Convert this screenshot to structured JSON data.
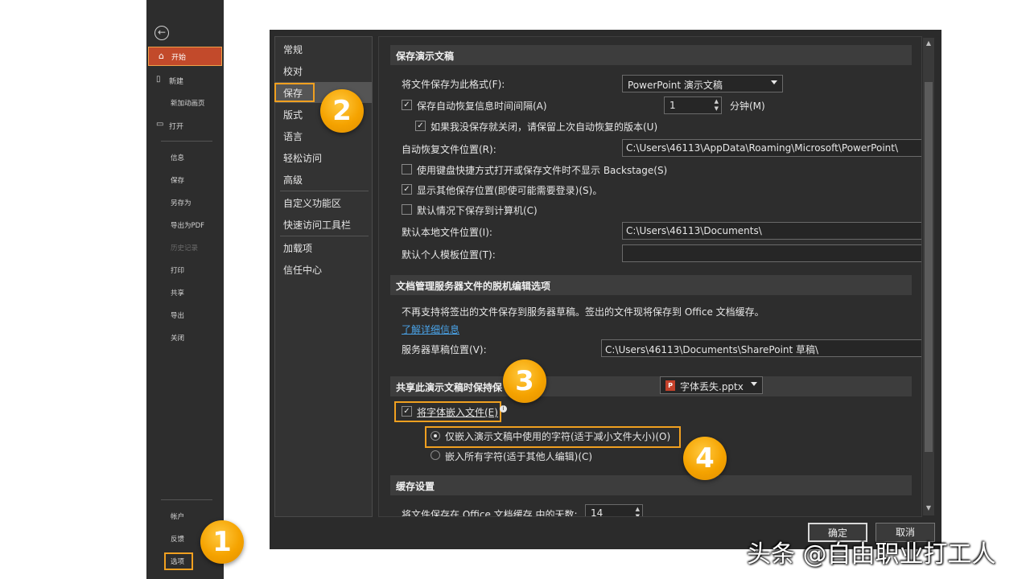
{
  "backstage": {
    "back_icon": "back-arrow-icon",
    "home": "开始",
    "new": "新建",
    "new_sub": "新加动画页",
    "open": "打开",
    "items": [
      "信息",
      "保存",
      "另存为",
      "导出为PDF",
      "历史记录",
      "打印",
      "共享",
      "导出",
      "关闭"
    ],
    "bottom": [
      "帐户",
      "反馈",
      "选项"
    ]
  },
  "categories": [
    "常规",
    "校对",
    "保存",
    "版式",
    "语言",
    "轻松访问",
    "高级",
    "自定义功能区",
    "快速访问工具栏",
    "加载项",
    "信任中心"
  ],
  "save_section": {
    "header": "保存演示文稿",
    "format_label": "将文件保存为此格式(F):",
    "format_value": "PowerPoint 演示文稿",
    "autorecover_label": "保存自动恢复信息时间间隔(A)",
    "autorecover_value": "1",
    "autorecover_unit": "分钟(M)",
    "keep_last_label": "如果我没保存就关闭，请保留上次自动恢复的版本(U)",
    "autorecover_path_label": "自动恢复文件位置(R):",
    "autorecover_path": "C:\\Users\\46113\\AppData\\Roaming\\Microsoft\\PowerPoint\\",
    "no_backstage_label": "使用键盘快捷方式打开或保存文件时不显示 Backstage(S)",
    "show_more_label": "显示其他保存位置(即使可能需要登录)(S)。",
    "save_to_computer_label": "默认情况下保存到计算机(C)",
    "local_path_label": "默认本地文件位置(I):",
    "local_path": "C:\\Users\\46113\\Documents\\",
    "template_path_label": "默认个人模板位置(T):",
    "template_path": ""
  },
  "offline_section": {
    "header": "文档管理服务器文件的脱机编辑选项",
    "note": "不再支持将签出的文件保存到服务器草稿。签出的文件现将保存到 Office 文档缓存。",
    "link": "了解详细信息",
    "drafts_label": "服务器草稿位置(V):",
    "drafts_path": "C:\\Users\\46113\\Documents\\SharePoint 草稿\\"
  },
  "fidelity_section": {
    "header": "共享此演示文稿时保持保",
    "file_value": "字体丢失.pptx",
    "file_icon": "powerpoint-file-icon",
    "embed_label": "将字体嵌入文件(E)",
    "info_icon": "info-icon",
    "embed_used_label": "仅嵌入演示文稿中使用的字符(适于减小文件大小)(O)",
    "embed_all_label": "嵌入所有字符(适于其他人编辑)(C)"
  },
  "cache_section": {
    "header": "缓存设置",
    "days_label": "将文件保存在 Office 文档缓存 中的天数:",
    "days_value": "14"
  },
  "buttons": {
    "ok": "确定",
    "cancel": "取消"
  },
  "badges": [
    "1",
    "2",
    "3",
    "4"
  ],
  "watermark": "头条 @自由职业打工人",
  "colors": {
    "accent_orange": "#f0a020",
    "home_red": "#c24a2b",
    "link_blue": "#4aa3e8",
    "dialog_bg": "#2b2b2b"
  }
}
